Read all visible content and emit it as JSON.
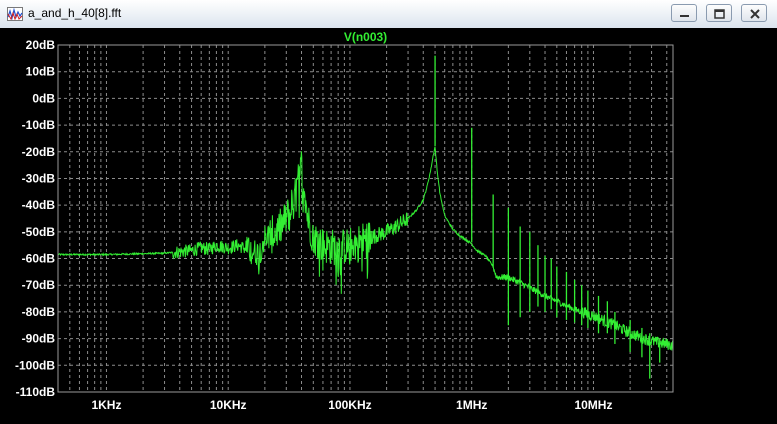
{
  "window": {
    "title": "a_and_h_40[8].fft",
    "buttons": [
      "minimize",
      "restore",
      "close"
    ]
  },
  "colors": {
    "background": "#000000",
    "grid": "#8c8c8c",
    "trace": "#33ee33",
    "text": "#ffffff"
  },
  "chart_data": {
    "type": "line",
    "title": "V(n003)",
    "xscale": "log",
    "xlim": [
      400,
      45000000
    ],
    "ylim": [
      -110,
      20
    ],
    "grid": true,
    "yticks": [
      20,
      10,
      0,
      -10,
      -20,
      -30,
      -40,
      -50,
      -60,
      -70,
      -80,
      -90,
      -100,
      -110
    ],
    "yticklabels": [
      "20dB",
      "10dB",
      "0dB",
      "-10dB",
      "-20dB",
      "-30dB",
      "-40dB",
      "-50dB",
      "-60dB",
      "-70dB",
      "-80dB",
      "-90dB",
      "-100dB",
      "-110dB"
    ],
    "xticks": [
      1000,
      10000,
      100000,
      1000000,
      10000000
    ],
    "xticklabels": [
      "1KHz",
      "10KHz",
      "100KHz",
      "1MHz",
      "10MHz"
    ],
    "series": [
      {
        "name": "V(n003)",
        "x": [
          400,
          1000,
          2000,
          3000,
          4000,
          5000,
          6000,
          7000,
          8000,
          10000,
          12000,
          15000,
          18000,
          20000,
          25000,
          30000,
          35000,
          38000,
          40000,
          42000,
          45000,
          50000,
          60000,
          80000,
          100000,
          130000,
          150000,
          200000,
          250000,
          300000,
          350000,
          400000,
          430000,
          460000,
          480000,
          500000,
          520000,
          550000,
          600000,
          700000,
          800000,
          900000,
          1000000,
          1100000,
          1300000,
          1500000,
          1600000,
          1800000,
          2000000,
          2200000,
          2500000,
          3000000,
          4000000,
          5000000,
          7000000,
          10000000,
          15000000,
          20000000,
          30000000,
          45000000
        ],
        "values": [
          -58.5,
          -58.5,
          -58.2,
          -58.0,
          -57.5,
          -57.0,
          -56.0,
          -56.5,
          -55.0,
          -56.0,
          -55.0,
          -57.0,
          -58.0,
          -52.0,
          -50.0,
          -45.0,
          -38.0,
          -30.0,
          -25.0,
          -32.0,
          -45.0,
          -52.0,
          -55.0,
          -56.0,
          -55.0,
          -53.0,
          -52.0,
          -50.0,
          -47.5,
          -45.0,
          -42.0,
          -38.0,
          -33.0,
          -27.0,
          -22.0,
          -18.0,
          -27.0,
          -36.0,
          -44.0,
          -49.0,
          -51.5,
          -53.0,
          -54.5,
          -57.0,
          -59.0,
          -63.0,
          -67.0,
          -67.0,
          -67.0,
          -68.0,
          -69.0,
          -71.0,
          -74.0,
          -76.0,
          -79.0,
          -81.5,
          -85.0,
          -88.0,
          -91.0,
          -92.5
        ]
      }
    ],
    "spurs": [
      {
        "x": 500000,
        "peak": 16,
        "base": -18
      },
      {
        "x": 1000000,
        "peak": -11,
        "base": -54
      },
      {
        "x": 1500000,
        "peak": -36,
        "base": -63
      },
      {
        "x": 2000000,
        "peak": -41,
        "base": -85
      },
      {
        "x": 2500000,
        "peak": -48,
        "base": -82
      },
      {
        "x": 3000000,
        "peak": -50,
        "base": -80
      },
      {
        "x": 3500000,
        "peak": -55,
        "base": -78
      },
      {
        "x": 4000000,
        "peak": -59,
        "base": -80
      },
      {
        "x": 4500000,
        "peak": -60,
        "base": -79
      },
      {
        "x": 5000000,
        "peak": -63,
        "base": -82
      },
      {
        "x": 6000000,
        "peak": -65,
        "base": -83
      },
      {
        "x": 7000000,
        "peak": -68,
        "base": -84
      },
      {
        "x": 8000000,
        "peak": -70,
        "base": -85
      },
      {
        "x": 9000000,
        "peak": -72,
        "base": -86
      },
      {
        "x": 11000000,
        "peak": -74,
        "base": -88
      },
      {
        "x": 13000000,
        "peak": -76,
        "base": -88
      },
      {
        "x": 15000000,
        "peak": -80,
        "base": -92
      },
      {
        "x": 20000000,
        "peak": -83,
        "base": -95
      },
      {
        "x": 25000000,
        "peak": -86,
        "base": -97
      },
      {
        "x": 29000000,
        "peak": -88,
        "base": -105
      },
      {
        "x": 35000000,
        "peak": -90,
        "base": -99
      }
    ]
  }
}
